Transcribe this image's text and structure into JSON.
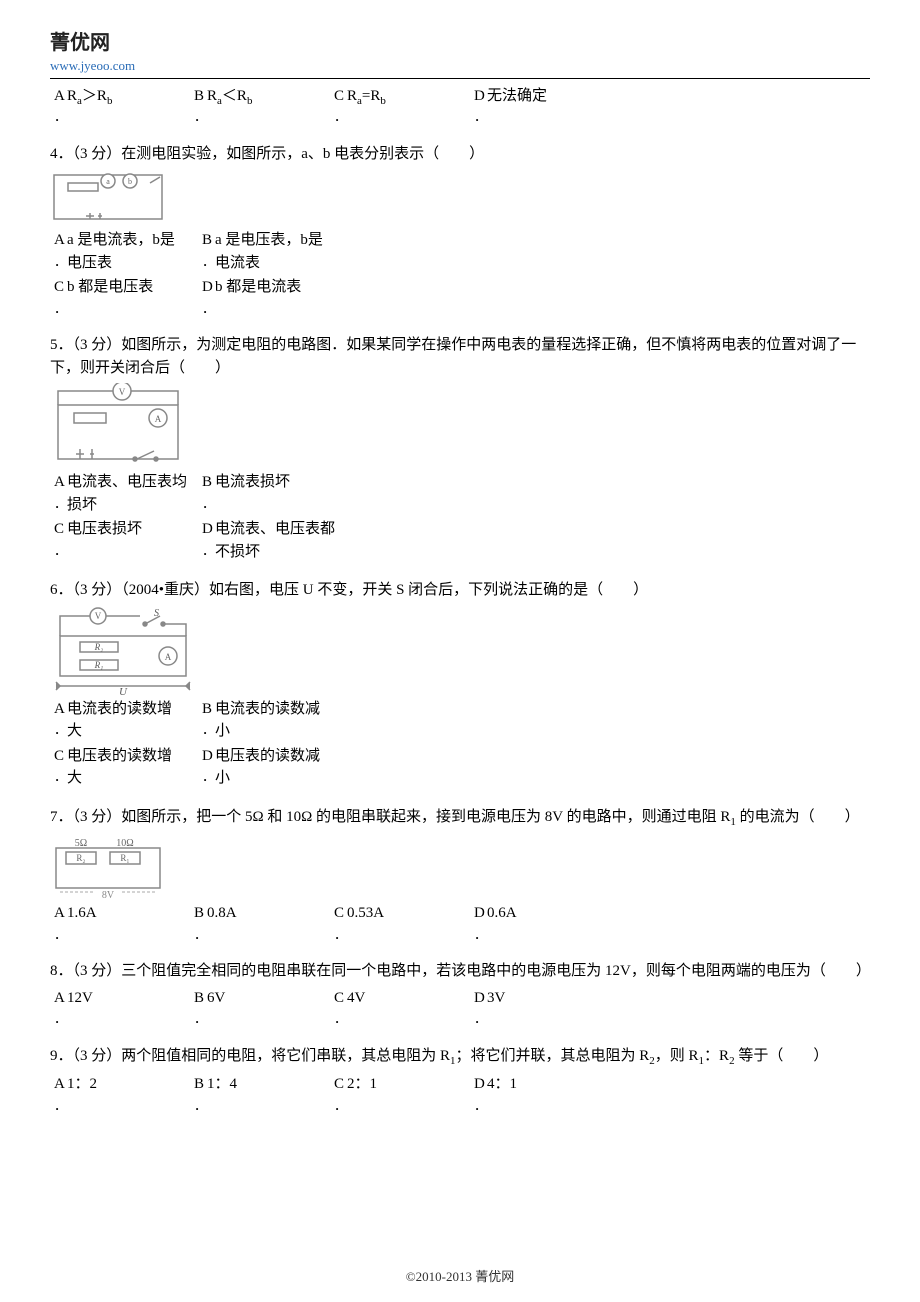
{
  "header": {
    "logo_text": "菁优网",
    "url": "www.jyeoo.com"
  },
  "q3_options": {
    "a_letter": "A",
    "a_dot": "．",
    "a_text_1": "R",
    "a_text_sub1": "a",
    "a_text_2": "＞R",
    "a_text_sub2": "b",
    "b_letter": "B",
    "b_dot": "．",
    "b_text_1": "R",
    "b_text_sub1": "a",
    "b_text_2": "＜R",
    "b_text_sub2": "b",
    "c_letter": "C",
    "c_dot": "．",
    "c_text_1": "R",
    "c_text_sub1": "a",
    "c_text_2": "=R",
    "c_text_sub2": "b",
    "d_letter": "D",
    "d_dot": "．",
    "d_text": "无法确定"
  },
  "q4": {
    "stem": "4．（3 分）在测电阻实验，如图所示，a、b 电表分别表示（　　）",
    "opts": {
      "a_letter": "A",
      "a_dot": "．",
      "a_text": "a 是电流表，b是电压表",
      "b_letter": "B",
      "b_dot": "．",
      "b_text": "a 是电压表，b是电流表",
      "c_letter": "C",
      "c_dot": "．",
      "c_text": "b 都是电压表",
      "d_letter": "D",
      "d_dot": "．",
      "d_text": "b 都是电流表"
    }
  },
  "q5": {
    "stem": "5．（3 分）如图所示，为测定电阻的电路图．如果某同学在操作中两电表的量程选择正确，但不慎将两电表的位置对调了一下，则开关闭合后（　　）",
    "opts": {
      "a_letter": "A",
      "a_dot": "．",
      "a_text": "电流表、电压表均损坏",
      "b_letter": "B",
      "b_dot": "．",
      "b_text": "电流表损坏",
      "c_letter": "C",
      "c_dot": "．",
      "c_text": "电压表损坏",
      "d_letter": "D",
      "d_dot": "．",
      "d_text": "电流表、电压表都不损坏"
    }
  },
  "q6": {
    "stem": "6．（3 分）（2004•重庆）如右图，电压 U 不变，开关 S 闭合后，下列说法正确的是（　　）",
    "labels": {
      "v": "V",
      "s": "S",
      "a": "A",
      "r1": "R₁",
      "r2": "R₂",
      "u": "U"
    },
    "opts": {
      "a_letter": "A",
      "a_dot": "．",
      "a_text": "电流表的读数增大",
      "b_letter": "B",
      "b_dot": "．",
      "b_text": "电流表的读数减小",
      "c_letter": "C",
      "c_dot": "．",
      "c_text": "电压表的读数增大",
      "d_letter": "D",
      "d_dot": "．",
      "d_text": "电压表的读数减小"
    }
  },
  "q7": {
    "stem_1": "7．（3 分）如图所示，把一个 5Ω 和 10Ω 的电阻串联起来，接到电源电压为 8V 的电路中，则通过电阻 R",
    "stem_sub": "1",
    "stem_2": " 的电流为（　　）",
    "labels": {
      "five": "5Ω",
      "ten": "10Ω",
      "r1": "R₁",
      "r2": "R₂",
      "v": "8V"
    },
    "opts": {
      "a_letter": "A",
      "a_dot": "．",
      "a_text": "1.6A",
      "b_letter": "B",
      "b_dot": "．",
      "b_text": "0.8A",
      "c_letter": "C",
      "c_dot": "．",
      "c_text": "0.53A",
      "d_letter": "D",
      "d_dot": "．",
      "d_text": "0.6A"
    }
  },
  "q8": {
    "stem": "8．（3 分）三个阻值完全相同的电阻串联在同一个电路中，若该电路中的电源电压为 12V，则每个电阻两端的电压为（　　）",
    "opts": {
      "a_letter": "A",
      "a_dot": "．",
      "a_text": "12V",
      "b_letter": "B",
      "b_dot": "．",
      "b_text": "6V",
      "c_letter": "C",
      "c_dot": "．",
      "c_text": "4V",
      "d_letter": "D",
      "d_dot": "．",
      "d_text": "3V"
    }
  },
  "q9": {
    "stem_1": "9．（3 分）两个阻值相同的电阻，将它们串联，其总电阻为 R",
    "stem_sub1": "1",
    "stem_2": "；将它们并联，其总电阻为 R",
    "stem_sub2": "2",
    "stem_3": "，则 R",
    "stem_sub3": "1",
    "stem_4": "：R",
    "stem_sub4": "2",
    "stem_5": " 等于（　　）",
    "opts": {
      "a_letter": "A",
      "a_dot": "．",
      "a_text": "1：2",
      "b_letter": "B",
      "b_dot": "．",
      "b_text": "1：4",
      "c_letter": "C",
      "c_dot": "．",
      "c_text": "2：1",
      "d_letter": "D",
      "d_dot": "．",
      "d_text": "4：1"
    }
  },
  "footer": "©2010-2013  菁优网"
}
